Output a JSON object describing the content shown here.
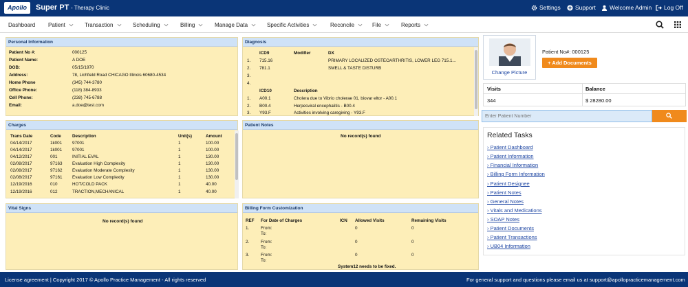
{
  "topbar": {
    "logo": "Apollo",
    "brand": "Super PT",
    "clinic": "- Therapy Clinic",
    "links": [
      "Settings",
      "Support",
      "Welcome Admin",
      "Log Off"
    ]
  },
  "nav": {
    "items": [
      "Dashboard",
      "Patient",
      "Transaction",
      "Scheduling",
      "Billing",
      "Manage Data",
      "Specific Activities",
      "Reconcile",
      "File",
      "Reports"
    ]
  },
  "personal": {
    "title": "Personal Information",
    "rows": [
      {
        "label": "Patient No #:",
        "value": "000125"
      },
      {
        "label": "Patient Name:",
        "value": "A DOE"
      },
      {
        "label": "DOB:",
        "value": "05/15/1970"
      },
      {
        "label": "Address:",
        "value": "78, Lichfield Road CHICAGO Illinois 60680-4534"
      },
      {
        "label": "Home Phone",
        "value": "(345) 744-3780"
      },
      {
        "label": "Office Phone:",
        "value": "(118) 384-8933"
      },
      {
        "label": "Cell Phone:",
        "value": "(238) 745-6788"
      },
      {
        "label": "Email:",
        "value": "a.doe@test.com"
      }
    ]
  },
  "diagnosis": {
    "title": "Diagnosis",
    "icd9_headers": [
      "ICD9",
      "Modifier",
      "DX"
    ],
    "icd9_rows": [
      {
        "n": "1.",
        "code": "715.16",
        "dx": "PRIMARY LOCALIZED OSTEOARTHRITIS, LOWER LEG 715.1..."
      },
      {
        "n": "2.",
        "code": "781.1",
        "dx": "SMELL & TASTE DISTURB"
      },
      {
        "n": "3.",
        "code": "",
        "dx": ""
      },
      {
        "n": "4.",
        "code": "",
        "dx": ""
      }
    ],
    "icd10_headers": [
      "ICD10",
      "Description"
    ],
    "icd10_rows": [
      {
        "n": "1.",
        "code": "A00.1",
        "dx": "Cholera due to Vibrio cholerae 01, biovar eltor - A00.1"
      },
      {
        "n": "2.",
        "code": "B00.4",
        "dx": "Herpesviral encephalitis - B00.4"
      },
      {
        "n": "3.",
        "code": "Y93.F",
        "dx": "Activities involving caregiving - Y93.F"
      }
    ]
  },
  "charges": {
    "title": "Charges",
    "headers": [
      "Trans Date",
      "Code",
      "Description",
      "Unit(s)",
      "Amount"
    ],
    "rows": [
      [
        "04/14/2017",
        "1k001",
        "97001",
        "1",
        "100.00"
      ],
      [
        "04/14/2017",
        "1k001",
        "97001",
        "1",
        "100.00"
      ],
      [
        "04/12/2017",
        "001",
        "INITIAL EVAL",
        "1",
        "130.00"
      ],
      [
        "02/08/2017",
        "97163",
        "Evaluation High Complexity",
        "1",
        "130.00"
      ],
      [
        "02/08/2017",
        "97162",
        "Evaluation Moderate Complexity",
        "1",
        "130.00"
      ],
      [
        "02/08/2017",
        "97161",
        "Evaluation Low Complexity",
        "1",
        "130.00"
      ],
      [
        "12/19/2016",
        "010",
        "HOT/COLD PACK",
        "1",
        "40.00"
      ],
      [
        "12/19/2016",
        "012",
        "TRACTION,MECHANICAL",
        "1",
        "40.00"
      ]
    ]
  },
  "patient_notes": {
    "title": "Patient Notes",
    "empty": "No record(s) found"
  },
  "vital_signs": {
    "title": "Vital Signs",
    "empty": "No record(s) found"
  },
  "billing_form": {
    "title": "Billing Form Customization",
    "headers": [
      "REF",
      "For Date of Charges",
      "ICN",
      "Allowed Visits",
      "Remaining Visits"
    ],
    "rows": [
      {
        "ref": "1.",
        "from": "From:",
        "to": "To:",
        "allowed": "0",
        "remaining": "0"
      },
      {
        "ref": "2.",
        "from": "From:",
        "to": "To:",
        "allowed": "0",
        "remaining": "0"
      },
      {
        "ref": "3.",
        "from": "From:",
        "to": "To:",
        "allowed": "0",
        "remaining": "0"
      }
    ],
    "note": "System12 needs to be fixed."
  },
  "right": {
    "change_picture": "Change Picture",
    "patient_no": "Patient No#: 000125",
    "add_documents": "+ Add Documents",
    "visits_label": "Visits",
    "balance_label": "Balance",
    "visits_value": "344",
    "balance_value": "$ 28280.00",
    "search_placeholder": "Enter Patient Number",
    "tasks_title": "Related Tasks",
    "tasks": [
      "Patient Dashboard",
      "Patient Information",
      "Financial Information",
      "Billing Form Information",
      "Patient Designee",
      "Patient Notes",
      "General Notes",
      "Vitals and Medications",
      "SOAP Notes",
      "Patient Documents",
      "Patient Transactions",
      "UB04 Information"
    ]
  },
  "footer": {
    "left": "License agreement | Copyright 2017 © Apollo Practice Management - All rights reserved",
    "right": "For general support and questions please email us at support@apollopracticemanagement.com"
  },
  "colors": {
    "topbar": "#0a3577",
    "panel_bg": "#fdeeb8",
    "panel_header": "#cfe2f7",
    "accent": "#f08a1c"
  },
  "icons": [
    "gear-icon",
    "plus-circle-icon",
    "user-icon",
    "logout-icon",
    "search-icon",
    "grid-icon",
    "chevron-down-icon"
  ]
}
